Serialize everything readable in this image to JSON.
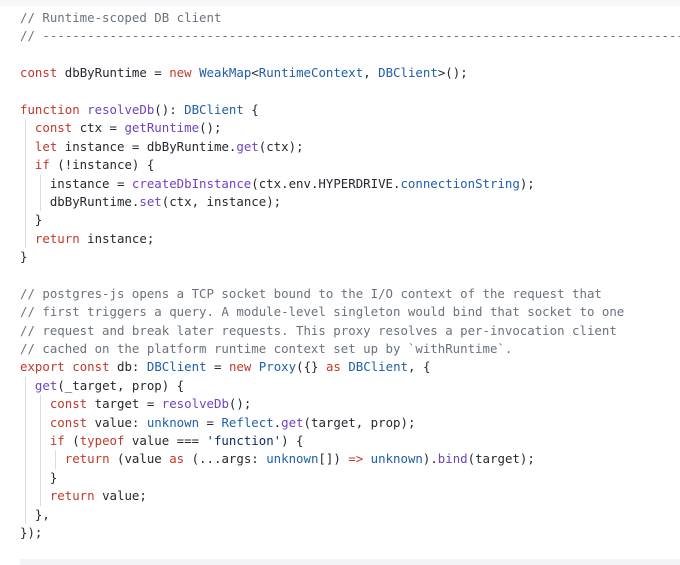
{
  "editor": {
    "lines": [
      {
        "tokens": [
          {
            "t": "// Runtime-scoped DB client",
            "c": "cm"
          }
        ]
      },
      {
        "tokens": [
          {
            "t": "// ----------------------------------------------------------------------------------------",
            "c": "cm"
          }
        ]
      },
      {
        "tokens": []
      },
      {
        "tokens": [
          {
            "t": "const",
            "c": "kw"
          },
          {
            "t": " dbByRuntime ",
            "c": "id"
          },
          {
            "t": "=",
            "c": "pn"
          },
          {
            "t": " new ",
            "c": "kw"
          },
          {
            "t": "WeakMap",
            "c": "ty"
          },
          {
            "t": "<",
            "c": "pn"
          },
          {
            "t": "RuntimeContext",
            "c": "ty"
          },
          {
            "t": ", ",
            "c": "pn"
          },
          {
            "t": "DBClient",
            "c": "ty"
          },
          {
            "t": ">();",
            "c": "pn"
          }
        ]
      },
      {
        "tokens": []
      },
      {
        "tokens": [
          {
            "t": "function",
            "c": "kw"
          },
          {
            "t": " ",
            "c": "pn"
          },
          {
            "t": "resolveDb",
            "c": "fn"
          },
          {
            "t": "(): ",
            "c": "pn"
          },
          {
            "t": "DBClient",
            "c": "ty"
          },
          {
            "t": " {",
            "c": "pn"
          }
        ]
      },
      {
        "guides": [
          1
        ],
        "tokens": [
          {
            "t": "  ",
            "c": "pn"
          },
          {
            "t": "const",
            "c": "kw"
          },
          {
            "t": " ctx ",
            "c": "id"
          },
          {
            "t": "= ",
            "c": "pn"
          },
          {
            "t": "getRuntime",
            "c": "fn"
          },
          {
            "t": "();",
            "c": "pn"
          }
        ]
      },
      {
        "guides": [
          1
        ],
        "tokens": [
          {
            "t": "  ",
            "c": "pn"
          },
          {
            "t": "let",
            "c": "kw"
          },
          {
            "t": " instance ",
            "c": "id"
          },
          {
            "t": "= ",
            "c": "pn"
          },
          {
            "t": "dbByRuntime",
            "c": "id"
          },
          {
            "t": ".",
            "c": "pn"
          },
          {
            "t": "get",
            "c": "fn"
          },
          {
            "t": "(ctx);",
            "c": "pn"
          }
        ]
      },
      {
        "guides": [
          1
        ],
        "tokens": [
          {
            "t": "  ",
            "c": "pn"
          },
          {
            "t": "if",
            "c": "kw"
          },
          {
            "t": " (!instance) {",
            "c": "pn"
          }
        ]
      },
      {
        "guides": [
          1,
          3
        ],
        "tokens": [
          {
            "t": "    instance ",
            "c": "id"
          },
          {
            "t": "= ",
            "c": "pn"
          },
          {
            "t": "createDbInstance",
            "c": "fn"
          },
          {
            "t": "(ctx.env.HYPERDRIVE.",
            "c": "pn"
          },
          {
            "t": "connectionString",
            "c": "ty"
          },
          {
            "t": ");",
            "c": "pn"
          }
        ]
      },
      {
        "guides": [
          1,
          3
        ],
        "tokens": [
          {
            "t": "    dbByRuntime",
            "c": "id"
          },
          {
            "t": ".",
            "c": "pn"
          },
          {
            "t": "set",
            "c": "fn"
          },
          {
            "t": "(ctx, instance);",
            "c": "pn"
          }
        ]
      },
      {
        "guides": [
          1
        ],
        "tokens": [
          {
            "t": "  }",
            "c": "pn"
          }
        ]
      },
      {
        "guides": [
          1
        ],
        "tokens": [
          {
            "t": "  ",
            "c": "pn"
          },
          {
            "t": "return",
            "c": "kw"
          },
          {
            "t": " instance;",
            "c": "pn"
          }
        ]
      },
      {
        "tokens": [
          {
            "t": "}",
            "c": "pn"
          }
        ]
      },
      {
        "tokens": []
      },
      {
        "tokens": [
          {
            "t": "// postgres-js opens a TCP socket bound to the I/O context of the request that",
            "c": "cm"
          }
        ]
      },
      {
        "tokens": [
          {
            "t": "// first triggers a query. A module-level singleton would bind that socket to one",
            "c": "cm"
          }
        ]
      },
      {
        "tokens": [
          {
            "t": "// request and break later requests. This proxy resolves a per-invocation client",
            "c": "cm"
          }
        ]
      },
      {
        "tokens": [
          {
            "t": "// cached on the platform runtime context set up by `withRuntime`.",
            "c": "cm"
          }
        ]
      },
      {
        "tokens": [
          {
            "t": "export",
            "c": "kw"
          },
          {
            "t": " ",
            "c": "pn"
          },
          {
            "t": "const",
            "c": "kw"
          },
          {
            "t": " db: ",
            "c": "id"
          },
          {
            "t": "DBClient",
            "c": "ty"
          },
          {
            "t": " = ",
            "c": "pn"
          },
          {
            "t": "new",
            "c": "kw"
          },
          {
            "t": " ",
            "c": "pn"
          },
          {
            "t": "Proxy",
            "c": "ty"
          },
          {
            "t": "({} ",
            "c": "pn"
          },
          {
            "t": "as",
            "c": "kw"
          },
          {
            "t": " ",
            "c": "pn"
          },
          {
            "t": "DBClient",
            "c": "ty"
          },
          {
            "t": ", {",
            "c": "pn"
          }
        ]
      },
      {
        "guides": [
          1
        ],
        "tokens": [
          {
            "t": "  ",
            "c": "pn"
          },
          {
            "t": "get",
            "c": "fn"
          },
          {
            "t": "(_target, prop) {",
            "c": "pn"
          }
        ]
      },
      {
        "guides": [
          1,
          3
        ],
        "tokens": [
          {
            "t": "    ",
            "c": "pn"
          },
          {
            "t": "const",
            "c": "kw"
          },
          {
            "t": " target ",
            "c": "id"
          },
          {
            "t": "= ",
            "c": "pn"
          },
          {
            "t": "resolveDb",
            "c": "fn"
          },
          {
            "t": "();",
            "c": "pn"
          }
        ]
      },
      {
        "guides": [
          1,
          3
        ],
        "tokens": [
          {
            "t": "    ",
            "c": "pn"
          },
          {
            "t": "const",
            "c": "kw"
          },
          {
            "t": " value: ",
            "c": "id"
          },
          {
            "t": "unknown",
            "c": "ty"
          },
          {
            "t": " = ",
            "c": "pn"
          },
          {
            "t": "Reflect",
            "c": "ty"
          },
          {
            "t": ".",
            "c": "pn"
          },
          {
            "t": "get",
            "c": "fn"
          },
          {
            "t": "(target, prop);",
            "c": "pn"
          }
        ]
      },
      {
        "guides": [
          1,
          3
        ],
        "tokens": [
          {
            "t": "    ",
            "c": "pn"
          },
          {
            "t": "if",
            "c": "kw"
          },
          {
            "t": " (",
            "c": "pn"
          },
          {
            "t": "typeof",
            "c": "kw"
          },
          {
            "t": " value ",
            "c": "id"
          },
          {
            "t": "=== ",
            "c": "pn"
          },
          {
            "t": "'function'",
            "c": "str"
          },
          {
            "t": ") {",
            "c": "pn"
          }
        ]
      },
      {
        "guides": [
          1,
          3,
          5
        ],
        "tokens": [
          {
            "t": "      ",
            "c": "pn"
          },
          {
            "t": "return",
            "c": "kw"
          },
          {
            "t": " (value ",
            "c": "pn"
          },
          {
            "t": "as",
            "c": "kw"
          },
          {
            "t": " (...args: ",
            "c": "pn"
          },
          {
            "t": "unknown",
            "c": "ty"
          },
          {
            "t": "[]) ",
            "c": "pn"
          },
          {
            "t": "=>",
            "c": "kw"
          },
          {
            "t": " ",
            "c": "pn"
          },
          {
            "t": "unknown",
            "c": "ty"
          },
          {
            "t": ").",
            "c": "pn"
          },
          {
            "t": "bind",
            "c": "fn"
          },
          {
            "t": "(target);",
            "c": "pn"
          }
        ]
      },
      {
        "guides": [
          1,
          3
        ],
        "tokens": [
          {
            "t": "    }",
            "c": "pn"
          }
        ]
      },
      {
        "guides": [
          1,
          3
        ],
        "tokens": [
          {
            "t": "    ",
            "c": "pn"
          },
          {
            "t": "return",
            "c": "kw"
          },
          {
            "t": " value;",
            "c": "pn"
          }
        ]
      },
      {
        "guides": [
          1
        ],
        "tokens": [
          {
            "t": "  },",
            "c": "pn"
          }
        ]
      },
      {
        "tokens": [
          {
            "t": "});",
            "c": "pn"
          }
        ]
      }
    ]
  }
}
